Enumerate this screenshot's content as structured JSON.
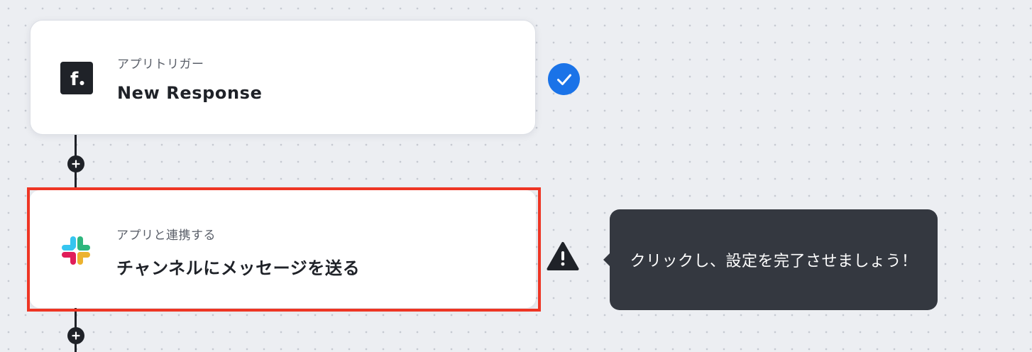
{
  "flow": {
    "steps": [
      {
        "kicker": "アプリトリガー",
        "title": "New Response",
        "app_icon": "formbricks-f-icon",
        "status": "complete",
        "status_icon": "check-circle-icon"
      },
      {
        "kicker": "アプリと連携する",
        "title": "チャンネルにメッセージを送る",
        "app_icon": "slack-icon",
        "status": "incomplete",
        "status_icon": "warning-triangle-icon",
        "highlighted": true
      }
    ],
    "add_step_icon": "plus-icon"
  },
  "tooltip": {
    "text": "クリックし、設定を完了させましょう！"
  },
  "colors": {
    "canvas": "#eceef2",
    "dot": "#c6cad2",
    "connector": "#1f2228",
    "check_blue": "#1a73e8",
    "highlight_red": "#ee3524",
    "tooltip_bg": "#343840",
    "slack_blue": "#36c5f0",
    "slack_green": "#2eb67d",
    "slack_yellow": "#ecb22e",
    "slack_red": "#e01e5a"
  }
}
